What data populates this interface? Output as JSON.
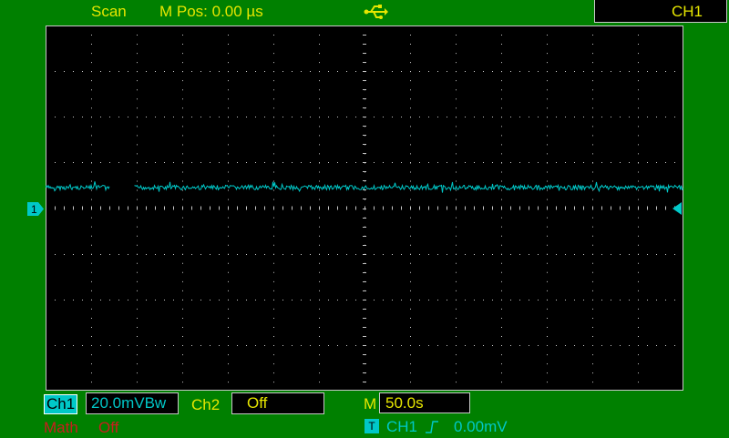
{
  "header": {
    "mode": "Scan",
    "position_label": "M Pos: 0.00 µs",
    "trigger_source": "CH1",
    "usb_icon": "usb-icon"
  },
  "display": {
    "trace_color": "#00c8c8",
    "grid_color": "#c8c8c8",
    "ch1_marker": "1",
    "trace_level_div": 0.45,
    "trace_gap_x_div": [
      1.4,
      1.95
    ]
  },
  "status": {
    "ch1_label": "Ch1",
    "ch1_scale": "20.0mVBw",
    "ch2_label": "Ch2",
    "ch2_state": "Off",
    "timebase_prefix": "M",
    "timebase": "50.0s",
    "math_label": "Math",
    "math_state": "Off",
    "trigger_icon": "T",
    "trigger_source": "CH1",
    "trigger_edge": "rising-edge-icon",
    "trigger_level": "0.00mV"
  },
  "colors": {
    "background": "#008000",
    "yellow_text": "#e6e600",
    "cyan": "#00c8c8",
    "math_red": "#c81e1e"
  }
}
